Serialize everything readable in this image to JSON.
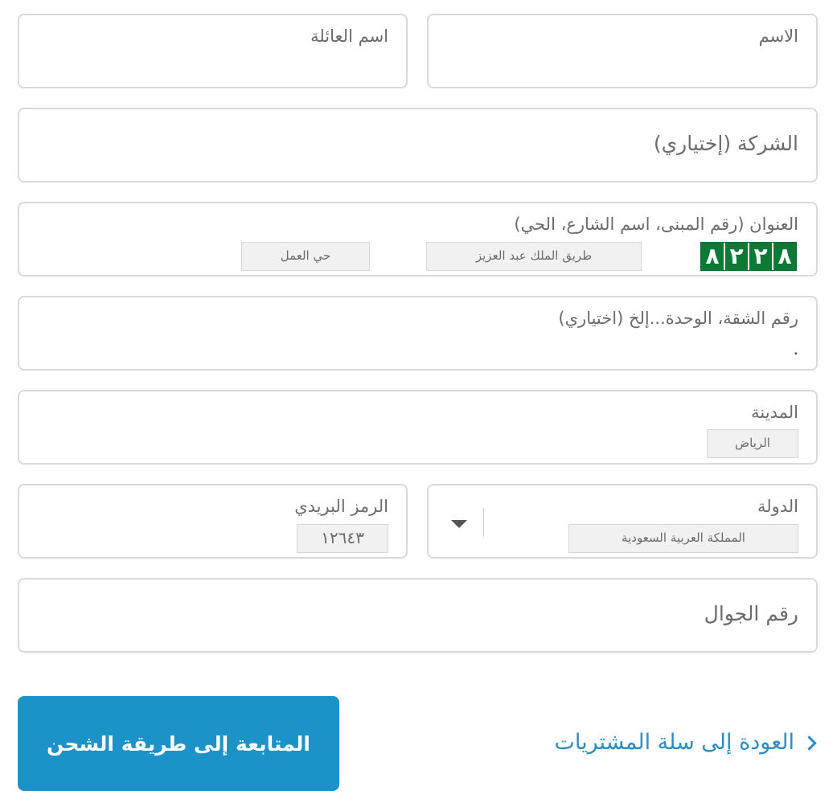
{
  "form": {
    "first_name": {
      "label": "الاسم"
    },
    "last_name": {
      "label": "اسم العائلة"
    },
    "company": {
      "label": "الشركة (إختياري)"
    },
    "address": {
      "label": "العنوان (رقم المبنى، اسم الشارع، الحي)",
      "example_building": [
        "٨",
        "٢",
        "٢",
        "٨"
      ],
      "example_street": "طريق الملك عبد العزيز",
      "example_district": "حي العمل"
    },
    "apartment": {
      "label": "رقم الشقة، الوحدة...إلخ (اختياري)",
      "value": "."
    },
    "city": {
      "label": "المدينة",
      "example": "الرياض"
    },
    "country": {
      "label": "الدولة",
      "example": "المملكة العربية السعودية"
    },
    "postal_code": {
      "label": "الرمز البريدي",
      "example": "١٢٦٤٣"
    },
    "phone": {
      "label": "رقم الجوال"
    }
  },
  "actions": {
    "continue_label": "المتابعة إلى طريقة الشحن",
    "back_label": "العودة إلى سلة المشتريات"
  },
  "colors": {
    "accent": "#1b92c8",
    "link": "#2a8fc0",
    "plate_green": "#0a7a36",
    "border": "#d9d9d9"
  }
}
